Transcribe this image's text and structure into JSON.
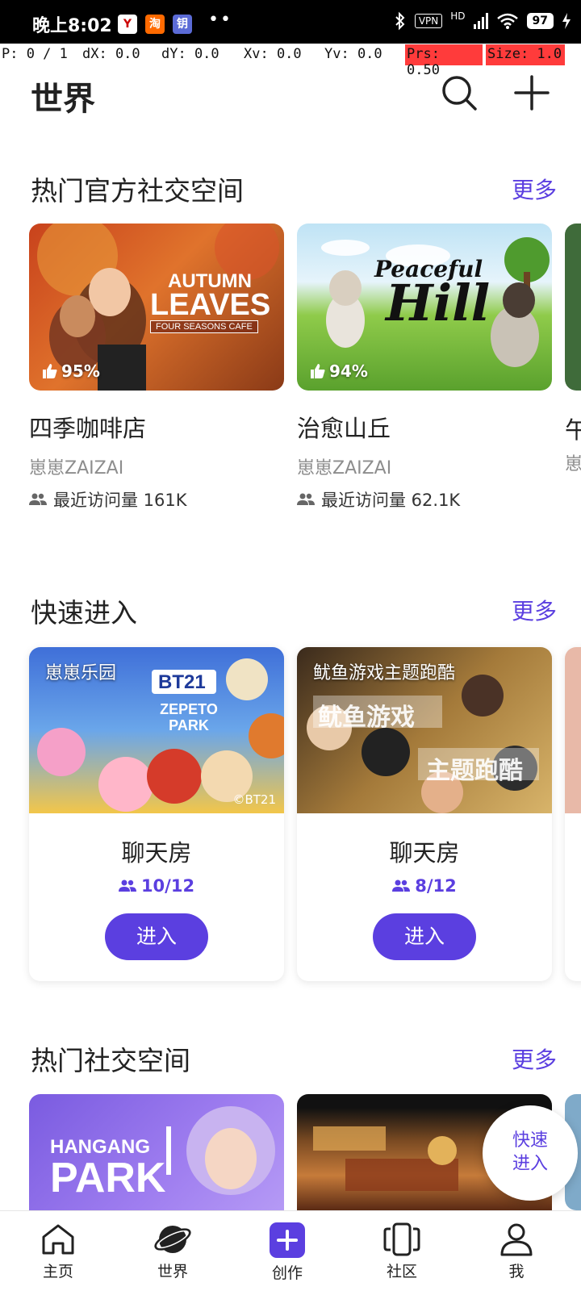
{
  "status_bar": {
    "time": "晚上8:02",
    "app_icons": [
      "Y",
      "淘",
      "钥"
    ],
    "vpn": "VPN",
    "network": "HD",
    "battery": "97"
  },
  "debug_overlay": {
    "pointer": "P: 0 / 1",
    "dx": "dX: 0.0",
    "dy": "dY: 0.0",
    "xv": "Xv: 0.0",
    "yv": "Yv: 0.0",
    "prs": "Prs: 0.50",
    "size": "Size: 1.0"
  },
  "header": {
    "title": "世界",
    "search_icon": "search-icon",
    "add_icon": "plus-icon"
  },
  "official_section": {
    "title": "热门官方社交空间",
    "more": "更多",
    "cards": [
      {
        "name": "四季咖啡店",
        "owner": "崽崽ZAIZAI",
        "visits": "最近访问量 161K",
        "rating": "95%",
        "banner_line1": "AUTUMN",
        "banner_line2": "LEAVES",
        "banner_sub": "FOUR SEASONS CAFE"
      },
      {
        "name": "治愈山丘",
        "owner": "崽崽ZAIZAI",
        "visits": "最近访问量 62.1K",
        "rating": "94%",
        "banner_line1": "Peaceful",
        "banner_line2": "Hill"
      }
    ],
    "partial_card": {
      "name": "午",
      "owner": "崽"
    }
  },
  "quick_section": {
    "title": "快速进入",
    "more": "更多",
    "cards": [
      {
        "label": "崽崽乐园",
        "banner_top": "BT21",
        "banner_mid": "ZEPETO PARK",
        "copyright": "©BT21",
        "room": "聊天房",
        "count": "10/12",
        "button": "进入"
      },
      {
        "label": "鱿鱼游戏主题跑酷",
        "banner_top": "鱿鱼游戏",
        "banner_mid": "主题跑酷",
        "room": "聊天房",
        "count": "8/12",
        "button": "进入"
      }
    ]
  },
  "hot_section": {
    "title": "热门社交空间",
    "more": "更多",
    "cards": [
      {
        "banner_line1": "HANGANG",
        "banner_line2": "PARK"
      },
      {
        "banner_line1": ""
      }
    ]
  },
  "fab": {
    "line1": "快速",
    "line2": "进入"
  },
  "bottom_nav": [
    {
      "label": "主页",
      "icon": "home-icon"
    },
    {
      "label": "世界",
      "icon": "planet-icon"
    },
    {
      "label": "创作",
      "icon": "create-plus-icon"
    },
    {
      "label": "社区",
      "icon": "community-icon"
    },
    {
      "label": "我",
      "icon": "profile-icon"
    }
  ],
  "colors": {
    "accent": "#5b3fe0",
    "debug_highlight": "#ff3b3b"
  }
}
